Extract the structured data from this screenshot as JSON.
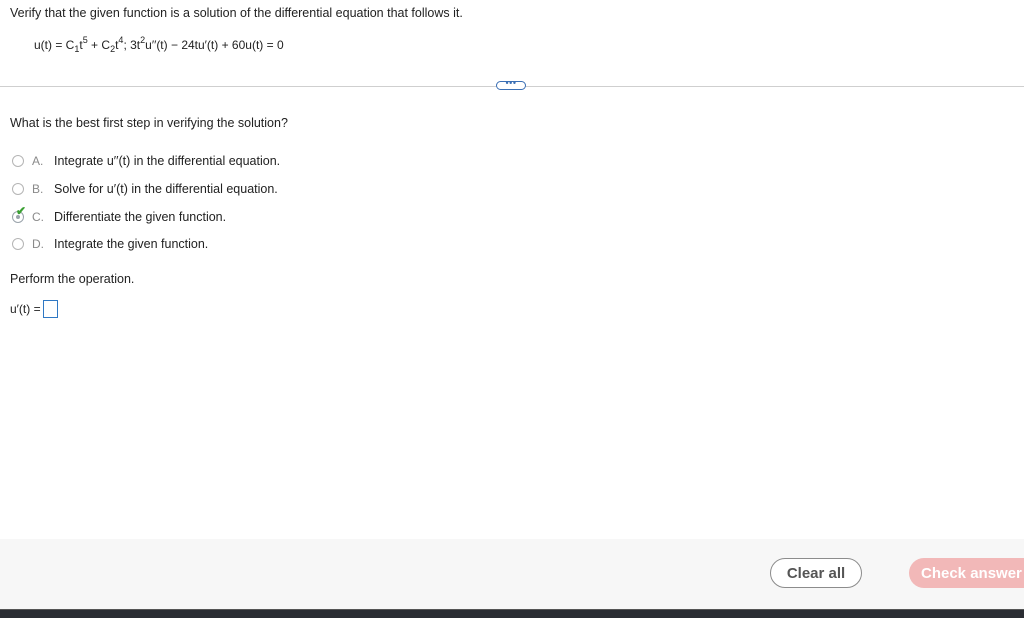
{
  "problem": {
    "prompt": "Verify that the given function is a solution of the differential equation that follows it.",
    "equation": {
      "p1": "u(t) = C",
      "sub1": "1",
      "p2": "t",
      "sup1": "5",
      "p3": " + C",
      "sub2": "2",
      "p4": "t",
      "sup2": "4",
      "p5": "; 3t",
      "sup3": "2",
      "p6": "u′′(t) − 24tu′(t) + 60u(t) = 0"
    }
  },
  "expand_button": {
    "label": "•••"
  },
  "question": {
    "text": "What is the best first step in verifying the solution?",
    "options": [
      {
        "letter": "A.",
        "text": "Integrate u′′(t) in the differential equation.",
        "selected": false
      },
      {
        "letter": "B.",
        "text": "Solve for u′(t) in the differential equation.",
        "selected": false
      },
      {
        "letter": "C.",
        "text": "Differentiate the given function.",
        "selected": true,
        "correct": true
      },
      {
        "letter": "D.",
        "text": "Integrate the given function.",
        "selected": false
      }
    ]
  },
  "check_mark": "✔",
  "perform": {
    "text": "Perform the operation.",
    "answer_label": "u′(t) ="
  },
  "footer": {
    "clear_label": "Clear all",
    "check_label": "Check answer"
  },
  "colors": {
    "accent": "#2f78c4",
    "correct": "#3aa032",
    "check_button_bg": "#f2b8b8"
  }
}
